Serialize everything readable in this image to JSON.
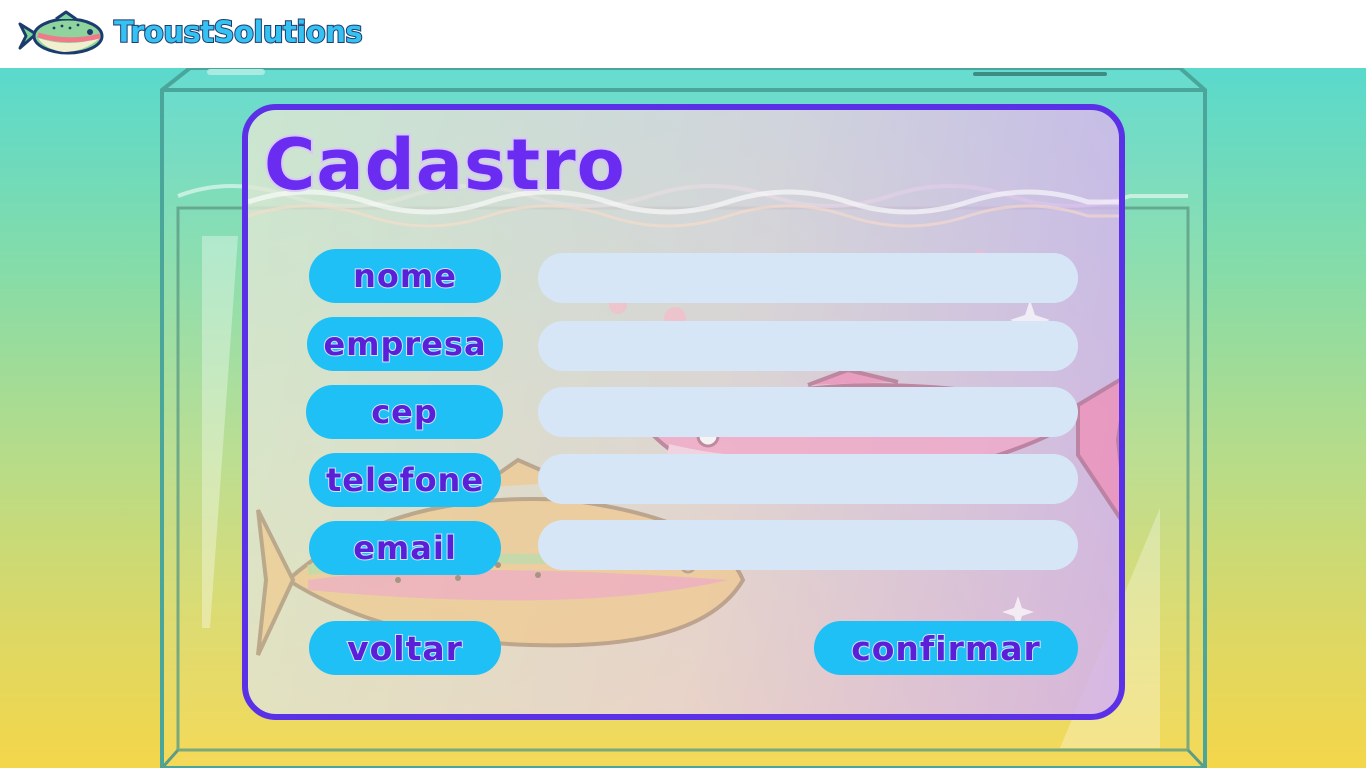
{
  "header": {
    "brand": "TroustSolutions",
    "logo_icon": "trout-fish-icon"
  },
  "form": {
    "title": "Cadastro",
    "fields": [
      {
        "label": "nome",
        "value": "",
        "placeholder": ""
      },
      {
        "label": "empresa",
        "value": "",
        "placeholder": ""
      },
      {
        "label": "cep",
        "value": "",
        "placeholder": ""
      },
      {
        "label": "telefone",
        "value": "",
        "placeholder": ""
      },
      {
        "label": "email",
        "value": "",
        "placeholder": ""
      }
    ],
    "back_label": "voltar",
    "confirm_label": "confirmar"
  },
  "colors": {
    "accent_purple": "#5a31e6",
    "pill_blue": "#1ec0f5",
    "input_bg": "#d6e6f6",
    "label_text": "#5a1fd6"
  }
}
